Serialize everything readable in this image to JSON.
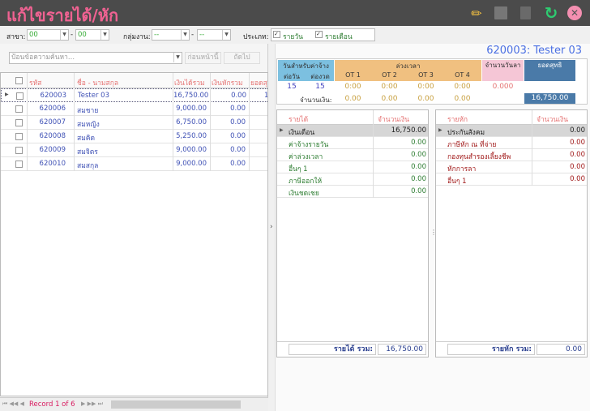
{
  "title": "แก้ไขรายได้/หัก",
  "toolbar": [
    "pencil-icon",
    "save-icon",
    "delete-doc-icon",
    "refresh-icon",
    "close-icon"
  ],
  "filters": {
    "branch_label": "สาขา:",
    "branch_from": "00",
    "branch_to": "00",
    "group_label": "กลุ่มงาน:",
    "group_from": "--",
    "group_to": "--",
    "type_label": "ประเภท:",
    "daily": "รายวัน",
    "monthly": "รายเดือน",
    "dash": "-"
  },
  "search": {
    "placeholder": "ป้อนข้อความค้นหา...",
    "prev": "ก่อนหน้านี้",
    "next": "ถัดไป"
  },
  "employees": {
    "headers": [
      "รหัส",
      "ชื่อ - นามสกุล",
      "เงินได้รวม",
      "เงินหักรวม",
      "ยอดสุ"
    ],
    "rows": [
      [
        "620003",
        "Tester  03",
        "16,750.00",
        "0.00",
        "1"
      ],
      [
        "620006",
        "สมชาย",
        "9,000.00",
        "0.00",
        ""
      ],
      [
        "620007",
        "สมหญิง",
        "6,750.00",
        "0.00",
        ""
      ],
      [
        "620008",
        "สมคิด",
        "5,250.00",
        "0.00",
        ""
      ],
      [
        "620009",
        "สมจิตร",
        "9,000.00",
        "0.00",
        ""
      ],
      [
        "620010",
        "สมสกุล",
        "9,000.00",
        "0.00",
        ""
      ]
    ]
  },
  "pager": {
    "record": "Record 1 of 6"
  },
  "detail": {
    "employee": "620003: Tester  03",
    "days_header": "วันสำหรับค่าจ้าง",
    "per_day": "ต่อวัน",
    "per_period": "ต่องวด",
    "ot_header": "ล่วงเวลา",
    "ot": [
      "OT 1",
      "OT 2",
      "OT 3",
      "OT 4"
    ],
    "leave_header": "จำนวนวันลา",
    "net_header": "ยอดสุทธิ",
    "days_val": "15",
    "period_val": "15",
    "ot_hours": [
      "0:00",
      "0:00",
      "0:00",
      "0:00"
    ],
    "leave_val": "0.000",
    "amount_label": "จำนวนเงิน:",
    "ot_amounts": [
      "0.00",
      "0.00",
      "0.00",
      "0.00"
    ],
    "net_val": "16,750.00"
  },
  "income": {
    "headers": [
      "รายได้",
      "จำนวนเงิน"
    ],
    "rows": [
      [
        "เงินเดือน",
        "16,750.00"
      ],
      [
        "ค่าจ้างรายวัน",
        "0.00"
      ],
      [
        "ค่าล่วงเวลา",
        "0.00"
      ],
      [
        "อื่นๆ 1",
        "0.00"
      ],
      [
        "ภาษีออกให้",
        "0.00"
      ],
      [
        "เงินชดเชย",
        "0.00"
      ]
    ],
    "total_label": "รายได้ รวม:",
    "total": "16,750.00"
  },
  "deduct": {
    "headers": [
      "รายหัก",
      "จำนวนเงิน"
    ],
    "rows": [
      [
        "ประกันสังคม",
        "0.00"
      ],
      [
        "ภาษีหัก ณ ที่จ่าย",
        "0.00"
      ],
      [
        "กองทุนสำรองเลี้ยงชีพ",
        "0.00"
      ],
      [
        "หักการลา",
        "0.00"
      ],
      [
        "อื่นๆ 1",
        "0.00"
      ]
    ],
    "total_label": "รายหัก รวม:",
    "total": "0.00"
  }
}
